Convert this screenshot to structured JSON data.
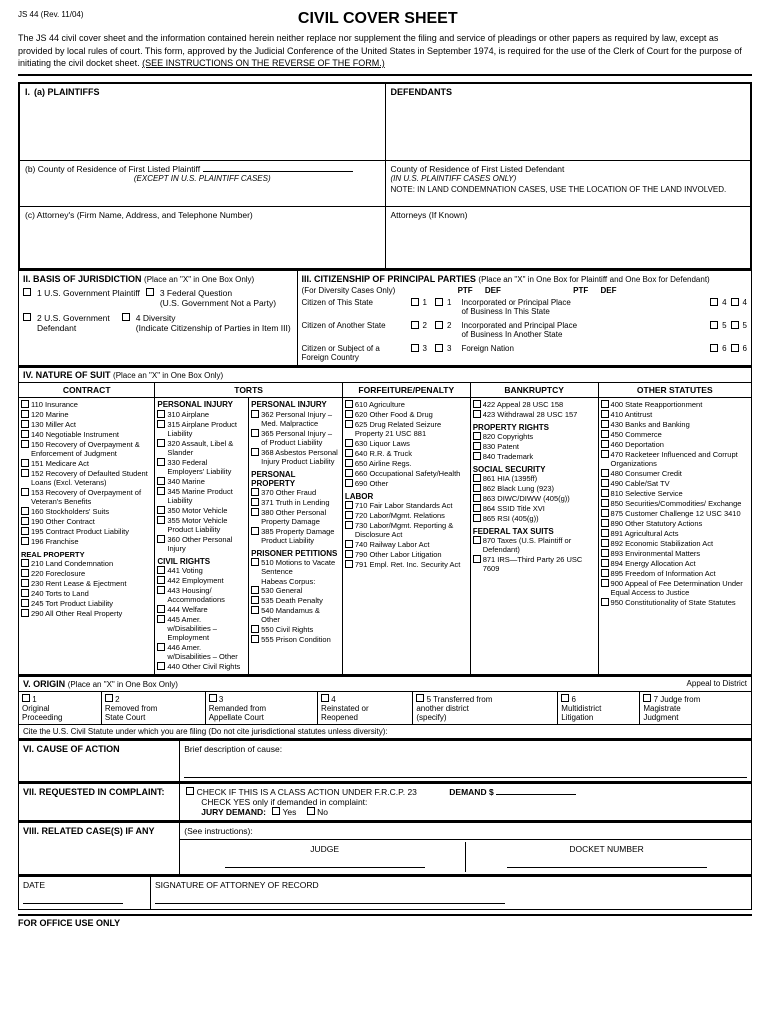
{
  "header": {
    "form_id": "JS 44 (Rev. 11/04)",
    "title": "CIVIL COVER SHEET"
  },
  "intro": {
    "text": "The JS 44 civil cover sheet and the information contained herein neither replace nor supplement the filing and service of pleadings or other papers as required by law, except as provided by local rules of court. This form, approved by the Judicial Conference of the United States in September 1974, is required for the use of the Clerk of Court for the purpose of initiating the civil docket sheet.",
    "underline_text": "(SEE INSTRUCTIONS ON THE REVERSE OF THE FORM.)"
  },
  "section_i": {
    "label": "I.",
    "plaintiffs_label": "(a) PLAINTIFFS",
    "defendants_label": "DEFENDANTS",
    "county_plaintiff_label": "(b) County of Residence of First Listed Plaintiff",
    "county_plaintiff_note": "(EXCEPT IN U.S. PLAINTIFF CASES)",
    "county_defendant_label": "County of Residence of First Listed Defendant",
    "county_defendant_note": "(IN U.S. PLAINTIFF CASES ONLY)",
    "land_note": "NOTE:  IN LAND CONDEMNATION CASES, USE THE LOCATION OF THE LAND INVOLVED.",
    "attorney_label": "(c) Attorney's (Firm Name, Address, and Telephone Number)",
    "attorneys_if_known": "Attorneys (If Known)"
  },
  "section_ii": {
    "label": "II. BASIS OF JURISDICTION",
    "instruction": "(Place an \"X\" in One Box Only)",
    "options": [
      {
        "number": "1",
        "text": "U.S. Government Plaintiff"
      },
      {
        "number": "3",
        "text": "Federal Question (U.S. Government Not a Party)"
      },
      {
        "number": "2",
        "text": "2 U.S. Government Defendant"
      },
      {
        "number": "4",
        "text": "4 Diversity (Indicate Citizenship of Parties in Item III)"
      }
    ]
  },
  "section_iii": {
    "label": "III. CITIZENSHIP OF PRINCIPAL PARTIES",
    "instruction_plaintiff": "(Place an \"X\" in One Box for Plaintiff",
    "instruction_defendant": "and One Box for Defendant)",
    "diversity_note": "(For Diversity Cases Only)",
    "ptf_label": "PTF",
    "def_label": "DEF",
    "rows": [
      {
        "label": "Citizen of This State",
        "ptf": "1",
        "def": "1",
        "description": "Incorporated or Principal Place of Business In This State",
        "ptf2": "4",
        "def2": "4"
      },
      {
        "label": "Citizen of Another State",
        "ptf": "2",
        "def": "2",
        "description": "Incorporated and Principal Place of Business In Another State",
        "ptf2": "5",
        "def2": "5"
      },
      {
        "label": "Citizen or Subject of a Foreign Country",
        "ptf": "3",
        "def": "3",
        "description": "Foreign Nation",
        "ptf2": "6",
        "def2": "6"
      }
    ]
  },
  "section_iv": {
    "label": "IV. NATURE OF SUIT",
    "instruction": "(Place an \"X\" in One Box Only)",
    "columns": {
      "contract": {
        "header": "CONTRACT",
        "items": [
          "110 Insurance",
          "120 Marine",
          "130 Miller Act",
          "140 Negotiable Instrument",
          "150 Recovery of Overpayment & Enforcement of Judgment",
          "151 Medicare Act",
          "152 Recovery of Defaulted Student Loans (Excl. Veterans)",
          "153 Recovery of Overpayment of Veteran's Benefits",
          "160 Stockholders' Suits",
          "190 Other Contract",
          "195 Contract Product Liability",
          "196 Franchise"
        ],
        "real_property_header": "REAL PROPERTY",
        "real_property_items": [
          "210 Land Condemnation",
          "220 Foreclosure",
          "230 Rent Lease & Ejectment",
          "240 Torts to Land",
          "245 Tort Product Liability",
          "290 All Other Real Property"
        ]
      },
      "torts_pi": {
        "header": "PERSONAL INJURY",
        "items_pi": [
          "310 Airplane",
          "315 Airplane Product Liability",
          "320 Assault, Libel & Slander",
          "330 Federal Employers' Liability",
          "340 Marine",
          "345 Marine Product Liability",
          "350 Motor Vehicle",
          "355 Motor Vehicle Product Liability",
          "360 Other Personal Injury"
        ],
        "civil_rights_header": "CIVIL RIGHTS",
        "civil_rights_items": [
          "441 Voting",
          "442 Employment",
          "443 Housing/ Accommodations",
          "444 Welfare",
          "445 Amer. w/Disabilities – Employment",
          "446 Amer. w/Disabilities – Other",
          "440 Other Civil Rights"
        ]
      },
      "torts_pp": {
        "header": "PERSONAL INJURY",
        "items": [
          "362 Personal Injury – Med. Malpractice",
          "365 Personal Injury – of Product Liability",
          "368 Asbestos Personal Injury Product Liability"
        ],
        "pp_header": "PERSONAL PROPERTY",
        "pp_items": [
          "370 Other Fraud",
          "371 Truth in Lending",
          "380 Other Personal Property Damage",
          "385 Property Damage Product Liability"
        ],
        "prisoner_header": "PRISONER PETITIONS",
        "prisoner_items": [
          "510 Motions to Vacate Sentence",
          "Habeas Corpus:",
          "530 General",
          "535 Death Penalty",
          "540 Mandamus & Other",
          "550 Civil Rights",
          "555 Prison Condition"
        ]
      },
      "forfeiture": {
        "header": "FORFEITURE/PENALTY",
        "items": [
          "610 Agriculture",
          "620 Other Food & Drug",
          "625 Drug Related Seizure Property 21 USC 881",
          "630 Liquor Laws",
          "640 R.R. & Truck",
          "650 Airline Regs.",
          "660 Occupational Safety/Health",
          "690 Other"
        ],
        "labor_header": "LABOR",
        "labor_items": [
          "710 Fair Labor Standards Act",
          "720 Labor/Mgmt. Relations",
          "730 Labor/Mgmt. Reporting & Disclosure Act",
          "740 Railway Labor Act",
          "790 Other Labor Litigation",
          "791 Empl. Ret. Inc. Security Act"
        ]
      },
      "bankruptcy": {
        "header": "BANKRUPTCY",
        "items": [
          "422 Appeal 28 USC 158",
          "423 Withdrawal 28 USC 157"
        ],
        "property_header": "PROPERTY RIGHTS",
        "property_items": [
          "820 Copyrights",
          "830 Patent",
          "840 Trademark"
        ],
        "social_header": "SOCIAL SECURITY",
        "social_items": [
          "861 HIA (1395ff)",
          "862 Black Lung (923)",
          "863 DIWC/DIWW (405(g))",
          "864 SSID Title XVI",
          "865 RSI (405(g))"
        ],
        "tax_header": "FEDERAL TAX SUITS",
        "tax_items": [
          "870 Taxes (U.S. Plaintiff or Defendant)",
          "871 IRS—Third Party 26 USC 7609"
        ]
      },
      "other_statutes": {
        "header": "OTHER STATUTES",
        "items": [
          "400 State Reapportionment",
          "410 Antitrust",
          "430 Banks and Banking",
          "450 Commerce",
          "460 Deportation",
          "470 Racketeer Influenced and Corrupt Organizations",
          "480 Consumer Credit",
          "490 Cable/Sat TV",
          "810 Selective Service",
          "850 Securities/Commodities/ Exchange",
          "875 Customer Challenge 12 USC 3410",
          "890 Other Statutory Actions",
          "891 Agricultural Acts",
          "892 Economic Stabilization Act",
          "893 Environmental Matters",
          "894 Energy Allocation Act",
          "895 Freedom of Information Act",
          "900 Appeal of Fee Determination Under Equal Access to Justice",
          "950 Constitutionality of State Statutes"
        ]
      }
    }
  },
  "section_v": {
    "label": "V. ORIGIN",
    "instruction": "(Place an \"X\" in One Box Only)",
    "appeal_text": "Appeal to District",
    "options": [
      {
        "number": "1",
        "label": "Original Proceeding"
      },
      {
        "number": "2",
        "label": "Removed from State Court"
      },
      {
        "number": "3",
        "label": "Remanded from Appellate Court"
      },
      {
        "number": "4",
        "label": "Reinstated or Reopened"
      },
      {
        "number": "5",
        "label": "Transferred from another district (specify)"
      },
      {
        "number": "6",
        "label": "Multidistrict Litigation"
      },
      {
        "number": "7",
        "label": "Judge from Magistrate Judgment"
      }
    ],
    "cite_text": "Cite the U.S. Civil Statute under which you are filing (Do not cite jurisdictional statutes unless diversity):"
  },
  "section_vi": {
    "label": "VI. CAUSE OF ACTION",
    "brief_description": "Brief description of cause:"
  },
  "section_vii": {
    "label": "VII. REQUESTED IN COMPLAINT:",
    "check_label": "CHECK IF THIS IS A CLASS ACTION UNDER F.R.C.P. 23",
    "demand_label": "DEMAND $",
    "check_yes_label": "CHECK YES only if demanded in complaint:",
    "jury_label": "JURY DEMAND:",
    "yes_label": "Yes",
    "no_label": "No"
  },
  "section_viii": {
    "label": "VIII. RELATED CASE(S) IF ANY",
    "see_instructions": "(See instructions):",
    "judge_label": "JUDGE",
    "docket_label": "DOCKET NUMBER"
  },
  "bottom": {
    "date_label": "DATE",
    "signature_label": "SIGNATURE OF ATTORNEY OF RECORD",
    "for_office_use": "FOR OFFICE USE ONLY"
  }
}
